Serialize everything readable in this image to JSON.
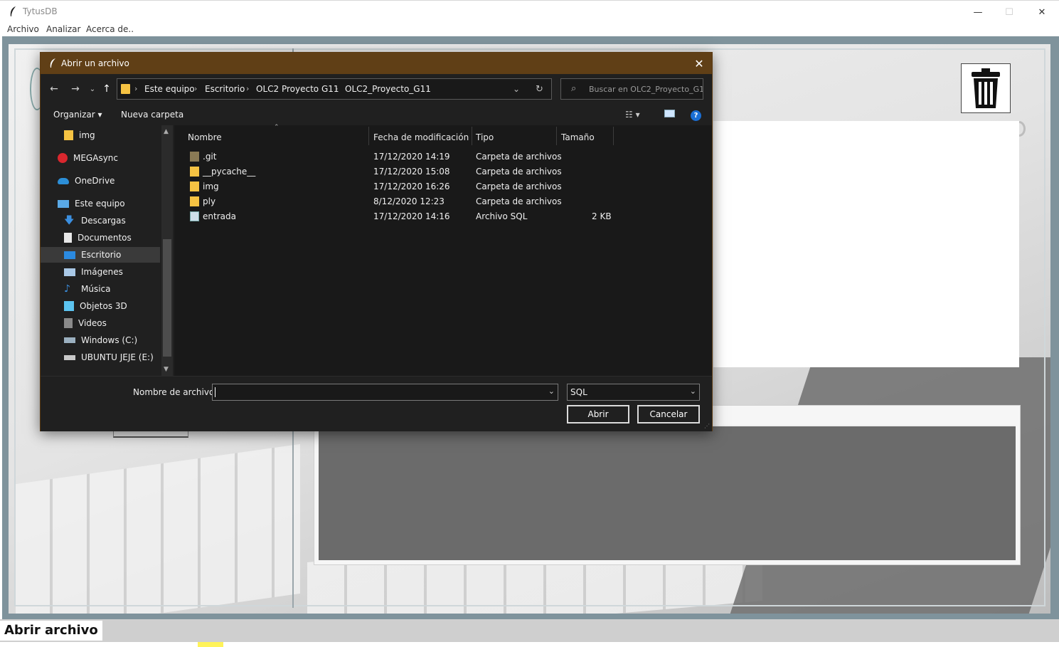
{
  "window": {
    "title": "TytusDB",
    "controls": {
      "minimize": "—",
      "maximize": "☐",
      "close": "✕"
    }
  },
  "menubar": {
    "items": [
      "Archivo",
      "Analizar",
      "Acerca de.."
    ]
  },
  "status": {
    "label": "Abrir archivo"
  },
  "dialog": {
    "title": "Abrir un archivo",
    "close": "✕",
    "breadcrumb": [
      "Este equipo",
      "Escritorio",
      "OLC2 Proyecto G11",
      "OLC2_Proyecto_G11"
    ],
    "search_placeholder": "Buscar en OLC2_Proyecto_G11",
    "toolbar": {
      "organize": "Organizar ▾",
      "new_folder": "Nueva carpeta"
    },
    "nav_items": [
      {
        "label": "img",
        "icon": "folder-icon"
      },
      {
        "label": "MEGAsync",
        "icon": "megasync-icon"
      },
      {
        "label": "OneDrive",
        "icon": "onedrive-icon"
      },
      {
        "label": "Este equipo",
        "icon": "computer-icon"
      },
      {
        "label": "Descargas",
        "icon": "download-icon"
      },
      {
        "label": "Documentos",
        "icon": "documents-icon"
      },
      {
        "label": "Escritorio",
        "icon": "desktop-icon",
        "selected": true
      },
      {
        "label": "Imágenes",
        "icon": "pictures-icon"
      },
      {
        "label": "Música",
        "icon": "music-icon"
      },
      {
        "label": "Objetos 3D",
        "icon": "objects3d-icon"
      },
      {
        "label": "Videos",
        "icon": "videos-icon"
      },
      {
        "label": "Windows (C:)",
        "icon": "drive-icon"
      },
      {
        "label": "UBUNTU JEJE (E:)",
        "icon": "drive-icon"
      }
    ],
    "columns": [
      "Nombre",
      "Fecha de modificación",
      "Tipo",
      "Tamaño"
    ],
    "files": [
      {
        "name": ".git",
        "date": "17/12/2020 14:19",
        "type": "Carpeta de archivos",
        "size": ""
      },
      {
        "name": "__pycache__",
        "date": "17/12/2020 15:08",
        "type": "Carpeta de archivos",
        "size": ""
      },
      {
        "name": "img",
        "date": "17/12/2020 16:26",
        "type": "Carpeta de archivos",
        "size": ""
      },
      {
        "name": "ply",
        "date": "8/12/2020 12:23",
        "type": "Carpeta de archivos",
        "size": ""
      },
      {
        "name": "entrada",
        "date": "17/12/2020 14:16",
        "type": "Archivo SQL",
        "size": "2 KB"
      }
    ],
    "filename_label": "Nombre de archivo:",
    "filename_value": "",
    "filetype": "SQL",
    "open_button": "Abrir",
    "cancel_button": "Cancelar"
  },
  "colors": {
    "dialog_title": "#603f16",
    "dialog_bg": "#202020",
    "frame": "#7f939c"
  }
}
